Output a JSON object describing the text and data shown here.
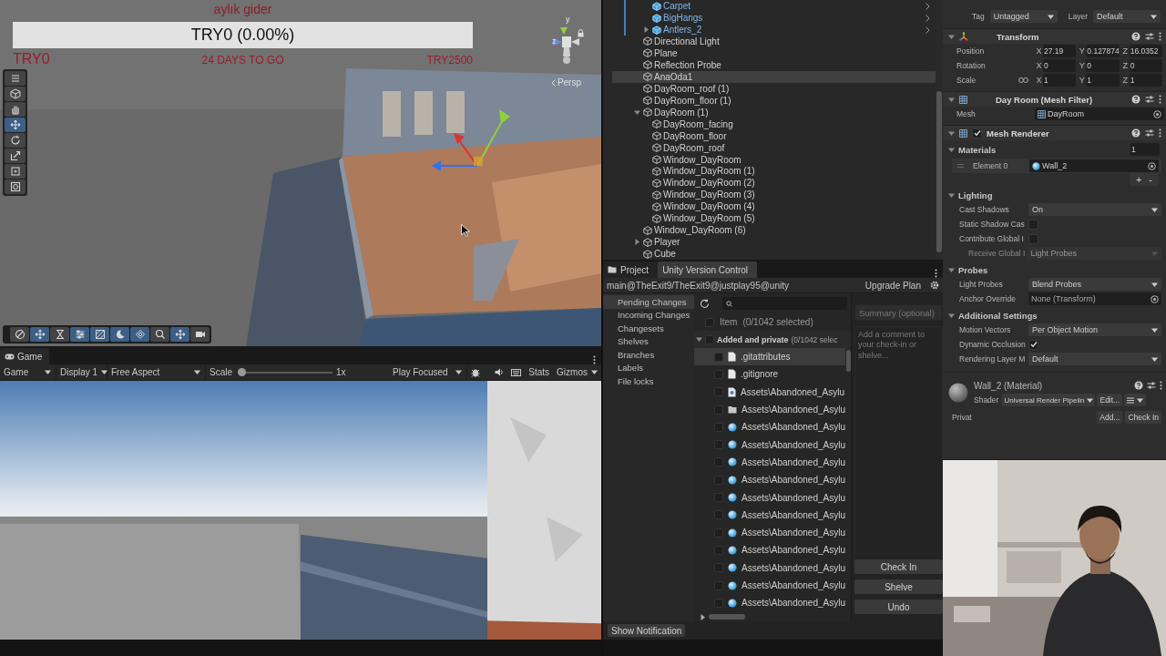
{
  "scene": {
    "title": "aylık gider",
    "progress_text": "TRY0 (0.00%)",
    "progress": {
      "level": 0
    },
    "start_label": "TRY0",
    "days_left": "24 DAYS TO GO",
    "goal_label": "TRY2500",
    "gizmo_axes": [
      "y",
      "z"
    ],
    "projection": "Persp",
    "side_tools": [
      {
        "kind": "grip",
        "selected": false
      },
      {
        "kind": "view",
        "selected": false
      },
      {
        "kind": "hand",
        "selected": false
      },
      {
        "kind": "move",
        "selected": true
      },
      {
        "kind": "rotate",
        "selected": false
      },
      {
        "kind": "scale",
        "selected": false
      },
      {
        "kind": "rect",
        "selected": false
      },
      {
        "kind": "transform",
        "selected": false
      }
    ],
    "bottom_tools": [
      {
        "kind": "compass",
        "on": false
      },
      {
        "kind": "move",
        "on": true
      },
      {
        "kind": "hourglass",
        "on": false
      },
      {
        "kind": "sliders",
        "on": true
      },
      {
        "kind": "grid",
        "on": true
      },
      {
        "kind": "moon",
        "on": true
      },
      {
        "kind": "layers",
        "on": true
      },
      {
        "kind": "search",
        "on": false
      },
      {
        "kind": "move",
        "on": true
      },
      {
        "kind": "camera",
        "on": false
      }
    ]
  },
  "game": {
    "tab": "Game",
    "view": "Game",
    "display": "Display 1",
    "aspect": "Free Aspect",
    "scale_label": "Scale",
    "scale": {
      "level": 0
    },
    "scale_value": "1x",
    "play_mode": "Play Focused",
    "stats": "Stats",
    "gizmos": "Gizmos"
  },
  "hierarchy": {
    "items": [
      {
        "children": [
          {
            "label": "Carpet",
            "kind": "prefab",
            "selected": false
          },
          {
            "label": "BigHangs",
            "kind": "prefab",
            "selected": false
          },
          {
            "label": "Antlers_2",
            "kind": "prefab",
            "selected": false,
            "expanded": false
          }
        ]
      },
      {
        "label": "Directional Light",
        "kind": "object",
        "selected": false
      },
      {
        "label": "Plane",
        "kind": "object",
        "selected": false
      },
      {
        "label": "Reflection Probe",
        "kind": "object",
        "selected": false
      },
      {
        "label": "AnaOda1",
        "kind": "object",
        "selected": true
      },
      {
        "label": "DayRoom_roof (1)",
        "kind": "object",
        "selected": false
      },
      {
        "label": "DayRoom_floor (1)",
        "kind": "object",
        "selected": false
      },
      {
        "label": "DayRoom (1)",
        "kind": "object",
        "selected": false,
        "expanded": true,
        "children": [
          {
            "label": "DayRoom_facing",
            "kind": "object",
            "selected": false
          },
          {
            "label": "DayRoom_floor",
            "kind": "object",
            "selected": false
          },
          {
            "label": "DayRoom_roof",
            "kind": "object",
            "selected": false
          },
          {
            "label": "Window_DayRoom",
            "kind": "object",
            "selected": false
          },
          {
            "label": "Window_DayRoom (1)",
            "kind": "object",
            "selected": false
          },
          {
            "label": "Window_DayRoom (2)",
            "kind": "object",
            "selected": false
          },
          {
            "label": "Window_DayRoom (3)",
            "kind": "object",
            "selected": false
          },
          {
            "label": "Window_DayRoom (4)",
            "kind": "object",
            "selected": false
          },
          {
            "label": "Window_DayRoom (5)",
            "kind": "object",
            "selected": false
          }
        ]
      },
      {
        "label": "Window_DayRoom (6)",
        "kind": "object",
        "selected": false
      },
      {
        "label": "Player",
        "kind": "object",
        "selected": false,
        "expanded": false
      },
      {
        "label": "Cube",
        "kind": "object",
        "selected": false
      }
    ]
  },
  "project": {
    "tabs": [
      {
        "label": "Project",
        "selected": false
      },
      {
        "label": "Unity Version Control",
        "selected": true
      }
    ],
    "path": "main@TheExit9/TheExit9@justplay95@unity",
    "upgrade": "Upgrade Plan",
    "nav": [
      {
        "label": "Pending Changes",
        "selected": true
      },
      {
        "label": "Incoming Changes",
        "selected": false
      },
      {
        "label": "Changesets",
        "selected": false
      },
      {
        "label": "Shelves",
        "selected": false
      },
      {
        "label": "Branches",
        "selected": false
      },
      {
        "label": "Labels",
        "selected": false
      },
      {
        "label": "File locks",
        "selected": false
      }
    ],
    "header": "Item",
    "header_count": "(0/1042 selected)",
    "header_checked": false,
    "group": {
      "label": "Added and private",
      "count": "(0/1042 selec",
      "expanded": true,
      "checked": false
    },
    "files": [
      {
        "name": ".gitattributes",
        "kind": "text",
        "checked": false,
        "selected": true
      },
      {
        "name": ".gitignore",
        "kind": "text",
        "checked": false,
        "selected": false
      },
      {
        "name": "Assets\\Abandoned_Asylu",
        "kind": "config",
        "checked": false,
        "selected": false
      },
      {
        "name": "Assets\\Abandoned_Asylu",
        "kind": "folder",
        "checked": false,
        "selected": false
      },
      {
        "name": "Assets\\Abandoned_Asylu",
        "kind": "material",
        "checked": false,
        "selected": false
      },
      {
        "name": "Assets\\Abandoned_Asylu",
        "kind": "material",
        "checked": false,
        "selected": false
      },
      {
        "name": "Assets\\Abandoned_Asylu",
        "kind": "material",
        "checked": false,
        "selected": false
      },
      {
        "name": "Assets\\Abandoned_Asylu",
        "kind": "material",
        "checked": false,
        "selected": false
      },
      {
        "name": "Assets\\Abandoned_Asylu",
        "kind": "material",
        "checked": false,
        "selected": false
      },
      {
        "name": "Assets\\Abandoned_Asylu",
        "kind": "material",
        "checked": false,
        "selected": false
      },
      {
        "name": "Assets\\Abandoned_Asylu",
        "kind": "material",
        "checked": false,
        "selected": false
      },
      {
        "name": "Assets\\Abandoned_Asylu",
        "kind": "material",
        "checked": false,
        "selected": false
      },
      {
        "name": "Assets\\Abandoned_Asylu",
        "kind": "material",
        "checked": false,
        "selected": false
      },
      {
        "name": "Assets\\Abandoned_Asylu",
        "kind": "material",
        "checked": false,
        "selected": false
      },
      {
        "name": "Assets\\Abandoned_Asylu",
        "kind": "material",
        "checked": false,
        "selected": false
      }
    ],
    "summary_placeholder": "Summary (optional)",
    "comment_placeholder": "Add a comment to your check-in or shelve...",
    "actions": [
      "Check In",
      "Shelve",
      "Undo"
    ],
    "notification": "Show Notification"
  },
  "inspector": {
    "tag_label": "Tag",
    "tag": "Untagged",
    "layer_label": "Layer",
    "layer": "Default",
    "transform": {
      "title": "Transform",
      "rows": [
        {
          "label": "Position",
          "axes": [
            "X",
            "Y",
            "Z"
          ],
          "values": [
            "27.19",
            "0.127874",
            "16.0352"
          ]
        },
        {
          "label": "Rotation",
          "axes": [
            "X",
            "Y",
            "Z"
          ],
          "values": [
            "0",
            "0",
            "0"
          ]
        },
        {
          "label": "Scale",
          "linked": true,
          "axes": [
            "X",
            "Y",
            "Z"
          ],
          "values": [
            "1",
            "1",
            "1"
          ]
        }
      ]
    },
    "mesh_filter": {
      "title": "Day Room (Mesh Filter)",
      "label": "Mesh",
      "value": "DayRoom"
    },
    "renderer": {
      "title": "Mesh Renderer",
      "enabled": true,
      "materials_label": "Materials",
      "count": "1",
      "elements": [
        {
          "label": "Element 0",
          "value": "Wall_2"
        }
      ],
      "add": "+",
      "remove": "-",
      "sections": [
        {
          "title": "Lighting",
          "rows": [
            {
              "kind": "dropdown",
              "label": "Cast Shadows",
              "value": "On",
              "disabled": false
            },
            {
              "kind": "checkbox",
              "label": "Static Shadow Cas",
              "checked": false
            },
            {
              "kind": "checkbox",
              "label": "Contribute Global I",
              "checked": false
            },
            {
              "kind": "dropdown",
              "label": "Receive Global I",
              "value": "Light Probes",
              "disabled": true
            }
          ]
        },
        {
          "title": "Probes",
          "rows": [
            {
              "kind": "dropdown",
              "label": "Light Probes",
              "value": "Blend Probes",
              "disabled": false
            },
            {
              "kind": "object",
              "label": "Anchor Override",
              "value": "None (Transform)",
              "disabled": false
            }
          ]
        },
        {
          "title": "Additional Settings",
          "rows": [
            {
              "kind": "dropdown",
              "label": "Motion Vectors",
              "value": "Per Object Motion",
              "disabled": false
            },
            {
              "kind": "checkbox",
              "label": "Dynamic Occlusion",
              "checked": true
            },
            {
              "kind": "dropdown",
              "label": "Rendering Layer M",
              "value": "Default",
              "disabled": false
            }
          ]
        }
      ]
    },
    "material": {
      "title": "Wall_2 (Material)",
      "shader_label": "Shader",
      "shader": "Universal Render Pipelin",
      "edit": "Edit...",
      "footer_label": "Privat",
      "add": "Add...",
      "check_in": "Check In"
    }
  }
}
